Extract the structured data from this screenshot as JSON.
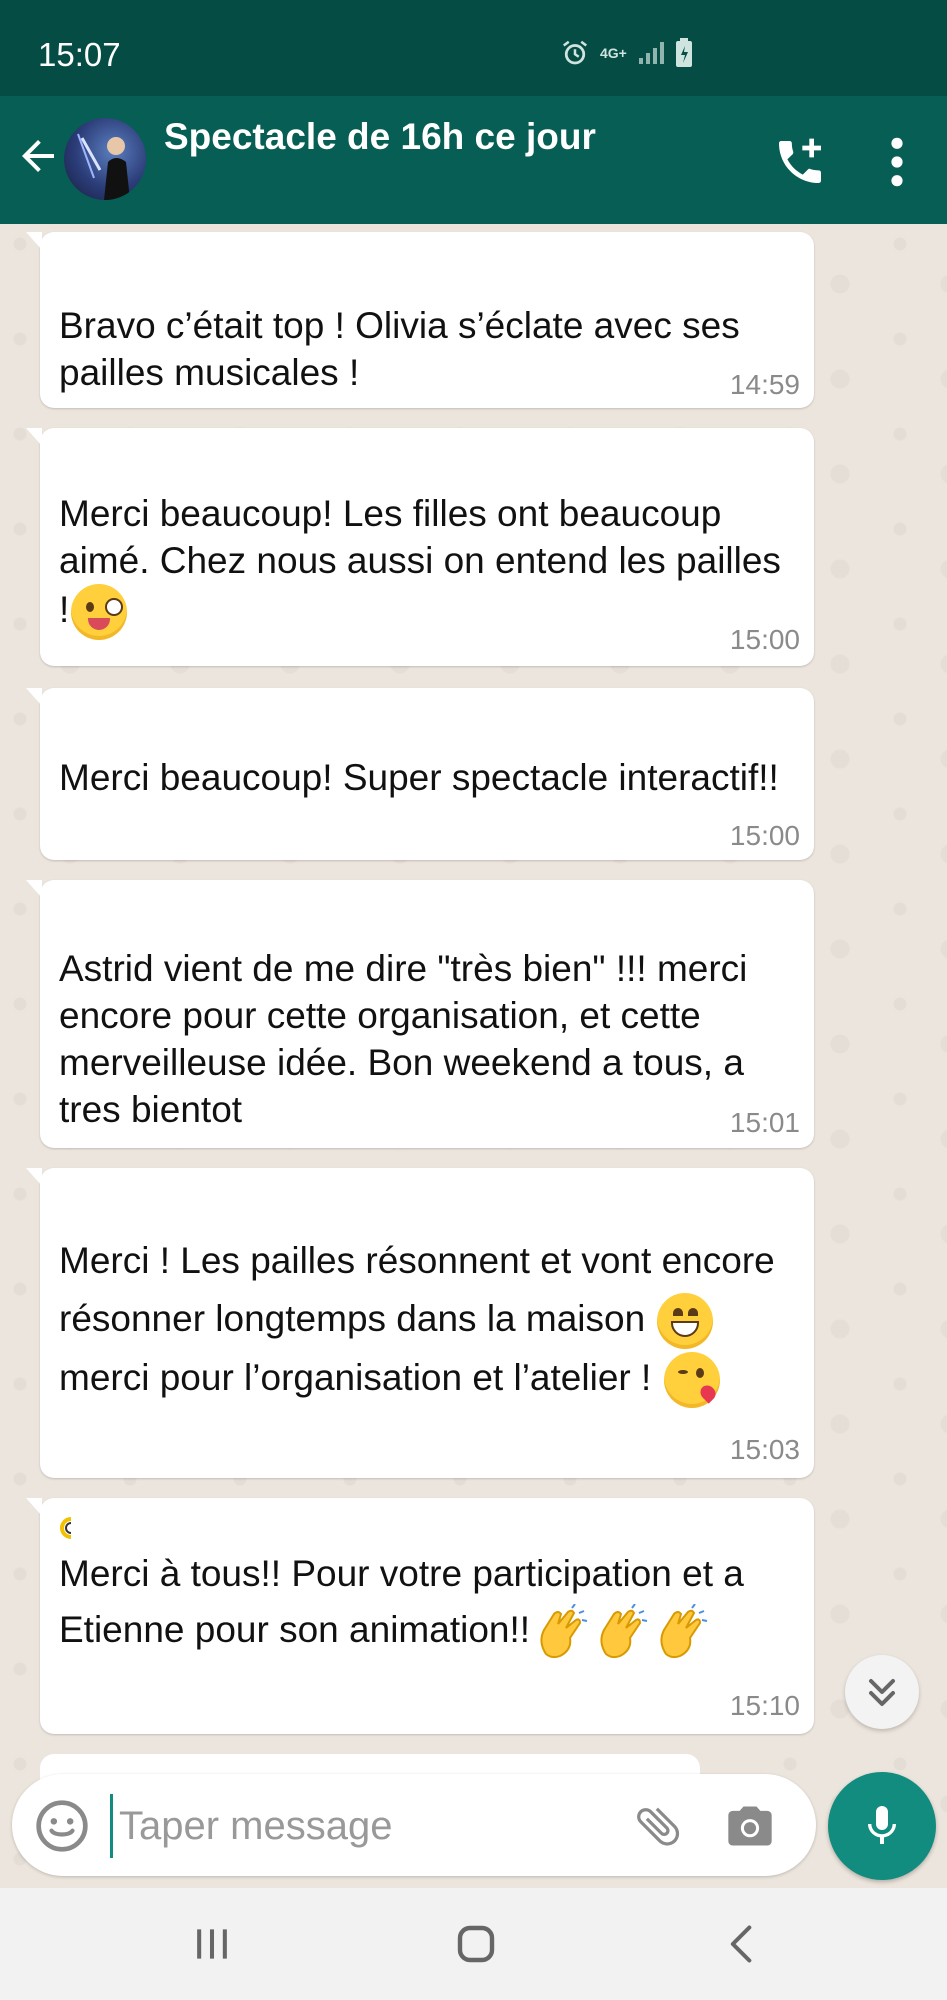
{
  "status_bar": {
    "time": "15:07",
    "network_label": "4G+",
    "icons": [
      "alarm-icon",
      "network-4g-icon",
      "signal-icon",
      "battery-icon"
    ]
  },
  "header": {
    "title": "Spectacle de 16h ce jour",
    "icons": [
      "back-arrow-icon",
      "add-call-icon",
      "more-vert-icon"
    ],
    "color": "#075e54"
  },
  "messages": [
    {
      "text": "Bravo c’était top ! Olivia s’éclate avec ses pailles musicales !",
      "time": "14:59"
    },
    {
      "text_before_emoji": "Merci beaucoup! Les filles ont beaucoup aimé. Chez nous aussi on entend les pailles !",
      "emoji": "winking-face-with-tongue",
      "time": "15:00"
    },
    {
      "text": "Merci beaucoup! Super spectacle interactif!!",
      "time": "15:00"
    },
    {
      "text": "Astrid vient de me dire \"très bien\" !!! merci encore pour cette organisation, et cette merveilleuse idée. Bon weekend a tous, a tres bientot",
      "time": "15:01"
    },
    {
      "part1": "Merci ! Les pailles résonnent et vont encore résonner longtemps dans la maison",
      "emoji1": "grinning-face",
      "part2": "merci pour l’organisation et l’atelier !",
      "emoji2": "face-blowing-kiss",
      "time": "15:03"
    },
    {
      "text": "Merci à tous!! Pour votre participation et a Etienne pour son animation!!",
      "emoji": "clapping-hands",
      "emoji_count": 3,
      "time": "15:10"
    }
  ],
  "composer": {
    "placeholder": "Taper message",
    "icons": [
      "emoji-icon",
      "attach-icon",
      "camera-icon",
      "mic-icon"
    ],
    "accent": "#128c7e"
  },
  "nav_bar": {
    "icons": [
      "recent-apps-icon",
      "home-icon",
      "back-icon"
    ]
  }
}
